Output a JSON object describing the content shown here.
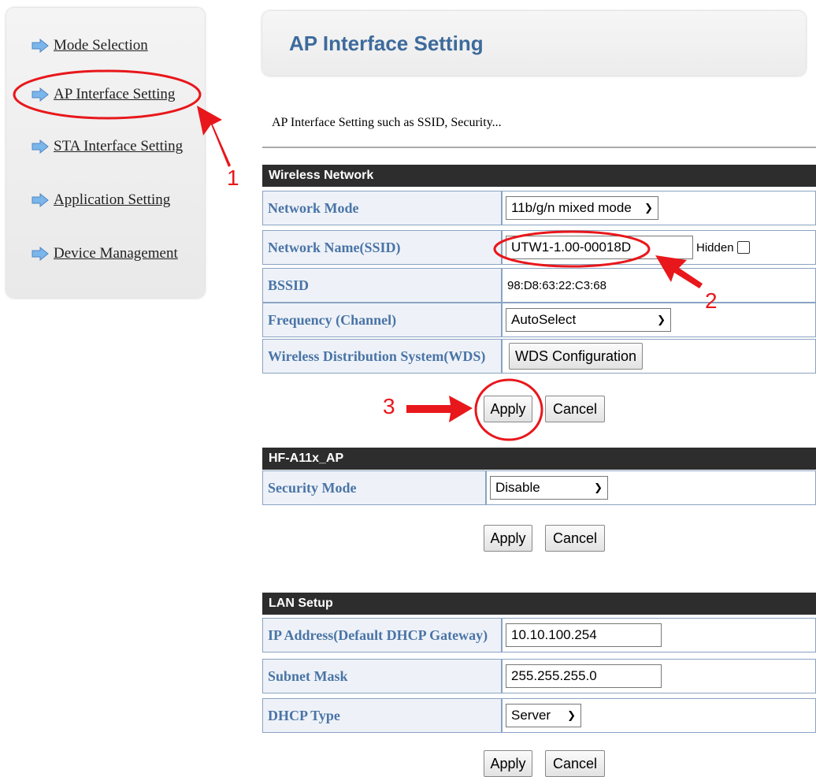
{
  "sidebar": {
    "items": [
      {
        "label": "Mode Selection"
      },
      {
        "label": "AP Interface Setting"
      },
      {
        "label": "STA Interface Setting"
      },
      {
        "label": "Application Setting"
      },
      {
        "label": "Device Management"
      }
    ]
  },
  "header": {
    "title": "AP Interface Setting",
    "description": "AP Interface Setting such as SSID, Security..."
  },
  "wireless": {
    "title": "Wireless Network",
    "network_mode_label": "Network Mode",
    "network_mode_value": "11b/g/n mixed mode",
    "ssid_label": "Network Name(SSID)",
    "ssid_value": "UTW1-1.00-00018D",
    "hidden_label": "Hidden",
    "bssid_label": "BSSID",
    "bssid_value": "98:D8:63:22:C3:68",
    "frequency_label": "Frequency (Channel)",
    "frequency_value": "AutoSelect",
    "wds_label": "Wireless Distribution System(WDS)",
    "wds_button": "WDS Configuration",
    "apply": "Apply",
    "cancel": "Cancel"
  },
  "security": {
    "title": "HF-A11x_AP",
    "mode_label": "Security Mode",
    "mode_value": "Disable",
    "apply": "Apply",
    "cancel": "Cancel"
  },
  "lan": {
    "title": "LAN Setup",
    "ip_label": "IP Address(Default DHCP Gateway)",
    "ip_value": "10.10.100.254",
    "mask_label": "Subnet Mask",
    "mask_value": "255.255.255.0",
    "dhcp_label": "DHCP Type",
    "dhcp_value": "Server",
    "apply": "Apply",
    "cancel": "Cancel"
  },
  "annotations": {
    "step1": "1",
    "step2": "2",
    "step3": "3",
    "color": "#e8171b"
  }
}
